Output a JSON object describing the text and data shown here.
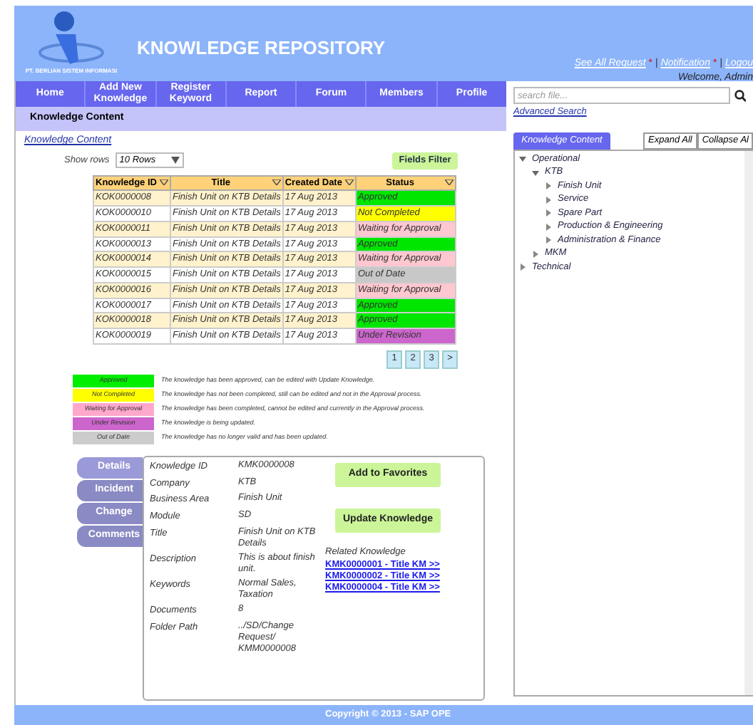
{
  "header": {
    "title": "KNOWLEDGE REPOSITORY",
    "company": "PT. BERLIAN SISTEM INFORMASI",
    "links": [
      "See All Request",
      "Notification",
      "Logou"
    ],
    "link_marker": "*",
    "separator": "|",
    "welcome": "Welcome, Admin"
  },
  "nav": [
    "Home",
    "Add New Knowledge",
    "Register Keyword",
    "Report",
    "Forum",
    "Members",
    "Profile"
  ],
  "section_title": "Knowledge Content",
  "breadcrumb": "Knowledge Content",
  "show_rows": {
    "label": "Show rows",
    "value": "10 Rows"
  },
  "fields_filter": "Fields Filter",
  "table": {
    "columns": [
      "Knowledge ID",
      "Title",
      "Created Date",
      "Status"
    ],
    "rows": [
      {
        "id": "KOK0000008",
        "title": "Finish Unit on KTB Details",
        "date": "17 Aug 2013",
        "status": "Approved",
        "color": "#00e600"
      },
      {
        "id": "KOK0000010",
        "title": "Finish Unit on KTB Details",
        "date": "17 Aug 2013",
        "status": "Not Completed",
        "color": "#ffff00"
      },
      {
        "id": "KOK0000011",
        "title": "Finish Unit on KTB Details",
        "date": "17 Aug 2013",
        "status": "Waiting for Approval",
        "color": "#ffc8d0"
      },
      {
        "id": "KOK0000013",
        "title": "Finish Unit on KTB Details",
        "date": "17 Aug 2013",
        "status": "Approved",
        "color": "#00e600"
      },
      {
        "id": "KOK0000014",
        "title": "Finish Unit on KTB Details",
        "date": "17 Aug 2013",
        "status": "Waiting for Approval",
        "color": "#ffc8d0"
      },
      {
        "id": "KOK0000015",
        "title": "Finish Unit on KTB Details",
        "date": "17 Aug 2013",
        "status": "Out of Date",
        "color": "#c8c8c8"
      },
      {
        "id": "KOK0000016",
        "title": "Finish Unit on KTB Details",
        "date": "17 Aug 2013",
        "status": "Waiting for Approval",
        "color": "#ffc8d0"
      },
      {
        "id": "KOK0000017",
        "title": "Finish Unit on KTB Details",
        "date": "17 Aug 2013",
        "status": "Approved",
        "color": "#00e600"
      },
      {
        "id": "KOK0000018",
        "title": "Finish Unit on KTB Details",
        "date": "17 Aug 2013",
        "status": "Approved",
        "color": "#00e600"
      },
      {
        "id": "KOK0000019",
        "title": "Finish Unit on KTB Details",
        "date": "17 Aug 2013",
        "status": "Under Revision",
        "color": "#cc66cc"
      }
    ]
  },
  "pagination": [
    "1",
    "2",
    "3",
    ">"
  ],
  "legend": [
    {
      "label": "Approved",
      "color": "#00ee00",
      "description": "The knowledge has been approved, can be edited with Update Knowledge."
    },
    {
      "label": "Not Completed",
      "color": "#ffff00",
      "description": "The knowledge has not been completed, still can be edited and not in the Approval process."
    },
    {
      "label": "Waiting for Approval",
      "color": "#ffa8cc",
      "description": "The knowledge has been completed, cannot be edited and currently in the Approval process."
    },
    {
      "label": "Under Revision",
      "color": "#cc66cc",
      "description": "The knowledge is being updated."
    },
    {
      "label": "Out of Date",
      "color": "#cccccc",
      "description": "The knowledge has no longer valid and has been updated."
    }
  ],
  "detail_tabs": [
    {
      "label": "Details",
      "selected": true
    },
    {
      "label": "Incident",
      "selected": false
    },
    {
      "label": "Change",
      "selected": false
    },
    {
      "label": "Comments",
      "selected": false
    }
  ],
  "details": [
    {
      "label": "Knowledge ID",
      "value": "KMK0000008"
    },
    {
      "label": "Company",
      "value": "KTB"
    },
    {
      "label": "Business Area",
      "value": "Finish Unit"
    },
    {
      "label": "Module",
      "value": "SD"
    },
    {
      "label": "Title",
      "value": "Finish Unit on KTB Details"
    },
    {
      "label": "Description",
      "value": "This is about finish unit."
    },
    {
      "label": "Keywords",
      "value": "Normal Sales, Taxation"
    },
    {
      "label": "Documents",
      "value": "8"
    },
    {
      "label": "Folder Path",
      "value": "../SD/Change Request/ KMM0000008"
    }
  ],
  "buttons": [
    "Add to Favorites",
    "Update Knowledge"
  ],
  "related": {
    "title": "Related Knowledge",
    "links": [
      "KMK0000001 - Title KM >>",
      "KMK0000002 - Title KM >>",
      "KMK0000004 - Title KM >>"
    ]
  },
  "sidebar": {
    "search": {
      "placeholder": "search file..."
    },
    "advanced_search": "Advanced Search",
    "tab": "Knowledge Content",
    "expand_all": "Expand All",
    "collapse_all": "Collapse Al",
    "tree": [
      {
        "label": "Operational",
        "expanded": true,
        "children": [
          {
            "label": "KTB",
            "expanded": true,
            "children": [
              {
                "label": "Finish Unit",
                "expanded": false
              },
              {
                "label": "Service",
                "expanded": false
              },
              {
                "label": "Spare Part",
                "expanded": false
              },
              {
                "label": "Production & Engineering",
                "expanded": false
              },
              {
                "label": "Administration & Finance",
                "expanded": false
              }
            ]
          },
          {
            "label": "MKM",
            "expanded": false
          }
        ]
      },
      {
        "label": "Technical",
        "expanded": false
      }
    ]
  },
  "footer": "Copyright © 2013 - SAP OPE"
}
